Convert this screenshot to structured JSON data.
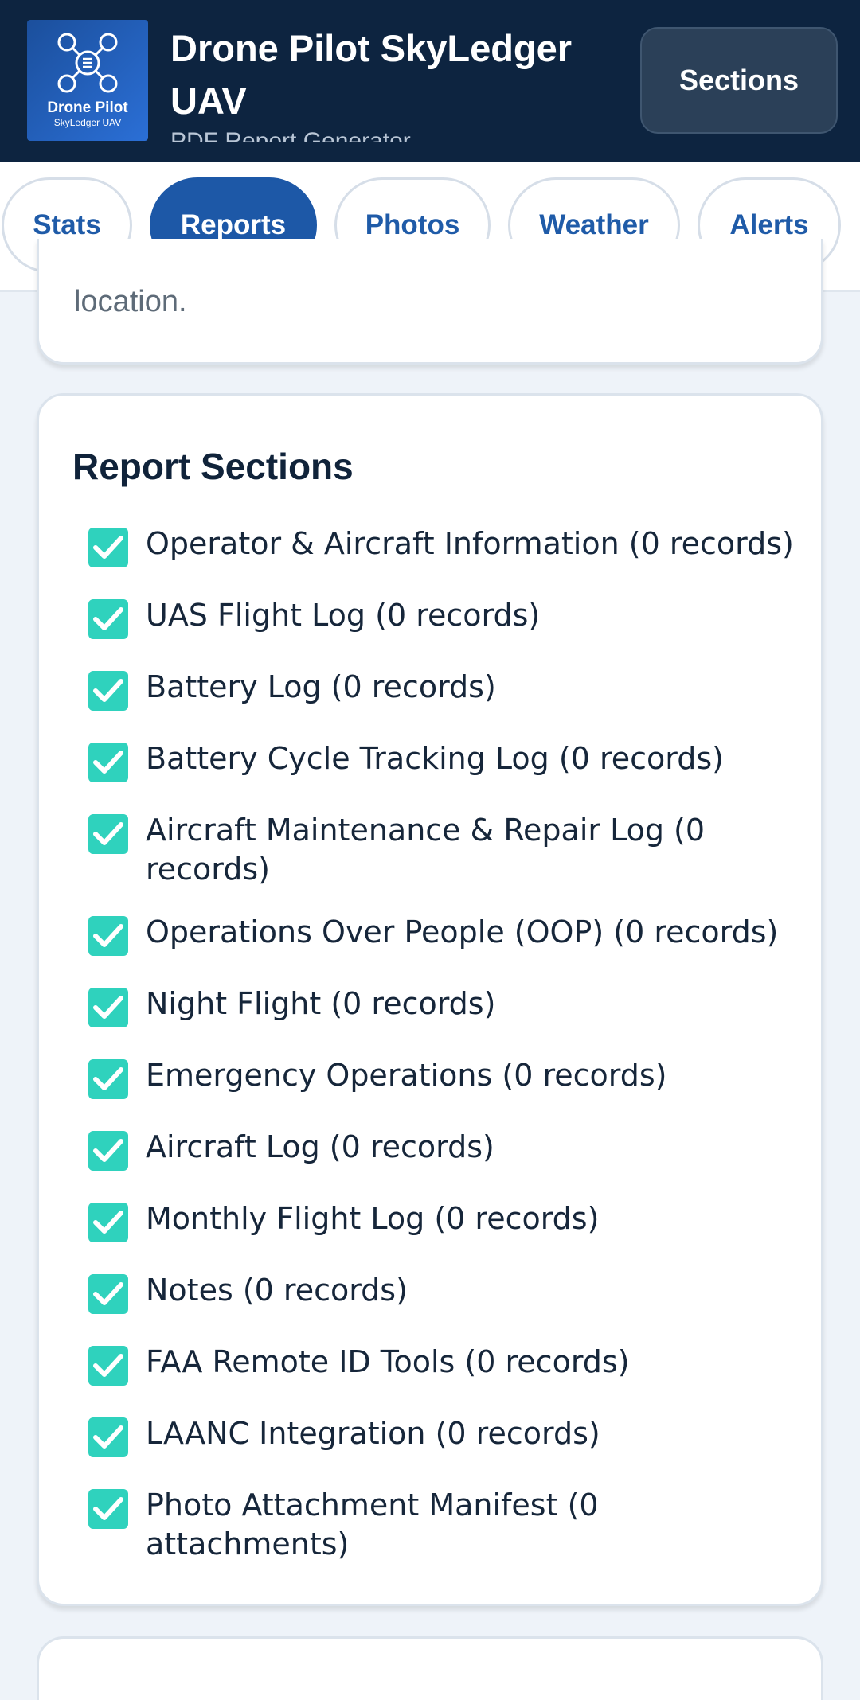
{
  "header": {
    "logo_line1": "Drone Pilot",
    "logo_line2": "SkyLedger UAV",
    "title": "Drone Pilot SkyLedger UAV",
    "subtitle": "PDF Report Generator",
    "sections_button": "Sections"
  },
  "tabs": [
    {
      "label": "Stats",
      "active": false
    },
    {
      "label": "Reports",
      "active": true
    },
    {
      "label": "Photos",
      "active": false
    },
    {
      "label": "Weather",
      "active": false
    },
    {
      "label": "Alerts",
      "active": false
    }
  ],
  "previous_card": {
    "text_fragment": "location."
  },
  "report_sections": {
    "title": "Report Sections",
    "items": [
      {
        "label": "Operator & Aircraft Information (0 records)",
        "checked": true
      },
      {
        "label": "UAS Flight Log (0 records)",
        "checked": true
      },
      {
        "label": "Battery Log (0 records)",
        "checked": true
      },
      {
        "label": "Battery Cycle Tracking Log (0 records)",
        "checked": true
      },
      {
        "label": "Aircraft Maintenance & Repair Log (0 records)",
        "checked": true
      },
      {
        "label": "Operations Over People (OOP) (0 records)",
        "checked": true
      },
      {
        "label": "Night Flight (0 records)",
        "checked": true
      },
      {
        "label": "Emergency Operations (0 records)",
        "checked": true
      },
      {
        "label": "Aircraft Log (0 records)",
        "checked": true
      },
      {
        "label": "Monthly Flight Log (0 records)",
        "checked": true
      },
      {
        "label": "Notes (0 records)",
        "checked": true
      },
      {
        "label": "FAA Remote ID Tools (0 records)",
        "checked": true
      },
      {
        "label": "LAANC Integration (0 records)",
        "checked": true
      },
      {
        "label": "Photo Attachment Manifest (0 attachments)",
        "checked": true
      }
    ]
  },
  "colors": {
    "header_bg": "#0d2440",
    "accent_blue": "#1d58a7",
    "checkbox_teal": "#2fd2bd",
    "page_bg": "#eef3f9"
  }
}
